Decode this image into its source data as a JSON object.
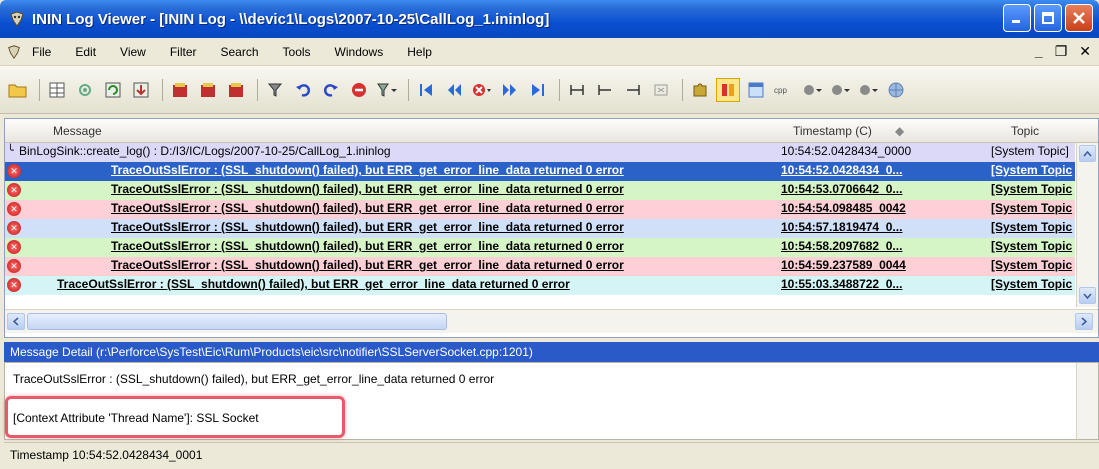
{
  "window": {
    "title": "ININ Log Viewer - [ININ Log - \\\\devic1\\Logs\\2007-10-25\\CallLog_1.ininlog]"
  },
  "menu": [
    {
      "label": "File"
    },
    {
      "label": "Edit"
    },
    {
      "label": "View"
    },
    {
      "label": "Filter"
    },
    {
      "label": "Search"
    },
    {
      "label": "Tools"
    },
    {
      "label": "Windows"
    },
    {
      "label": "Help"
    }
  ],
  "grid": {
    "columns": {
      "message": "Message",
      "timestamp": "Timestamp (C)",
      "topic": "Topic"
    },
    "rows": [
      {
        "message": "BinLogSink::create_log() : D:/I3/IC/Logs/2007-10-25/CallLog_1.ininlog",
        "timestamp": "10:54:52.0428434_0000",
        "topic": "[System Topic]"
      },
      {
        "message": "TraceOutSslError : (SSL_shutdown() failed), but ERR_get_error_line_data returned 0 error",
        "timestamp": "10:54:52.0428434_0...",
        "topic": "[System Topic"
      },
      {
        "message": "TraceOutSslError : (SSL_shutdown() failed), but ERR_get_error_line_data returned 0 error",
        "timestamp": "10:54:53.0706642_0...",
        "topic": "[System Topic"
      },
      {
        "message": "TraceOutSslError : (SSL_shutdown() failed), but ERR_get_error_line_data returned 0 error",
        "timestamp": "10:54:54.098485_0042",
        "topic": "[System Topic"
      },
      {
        "message": "TraceOutSslError : (SSL_shutdown() failed), but ERR_get_error_line_data returned 0 error",
        "timestamp": "10:54:57.1819474_0...",
        "topic": "[System Topic"
      },
      {
        "message": "TraceOutSslError : (SSL_shutdown() failed), but ERR_get_error_line_data returned 0 error",
        "timestamp": "10:54:58.2097682_0...",
        "topic": "[System Topic"
      },
      {
        "message": "TraceOutSslError : (SSL_shutdown() failed), but ERR_get_error_line_data returned 0 error",
        "timestamp": "10:54:59.237589_0044",
        "topic": "[System Topic"
      },
      {
        "message": "TraceOutSslError : (SSL_shutdown() failed), but ERR_get_error_line_data returned 0 error",
        "timestamp": "10:55:03.3488722_0...",
        "topic": "[System Topic"
      }
    ]
  },
  "detail": {
    "header": "Message Detail (r:\\Perforce\\SysTest\\Eic\\Rum\\Products\\eic\\src\\notifier\\SSLServerSocket.cpp:1201)",
    "line1": "TraceOutSslError : (SSL_shutdown() failed), but ERR_get_error_line_data returned 0 error",
    "line2": "[Context Attribute 'Thread Name']: SSL Socket"
  },
  "status": {
    "text": "Timestamp 10:54:52.0428434_0001"
  },
  "colors": {
    "title_bar": "#0a4fd0",
    "selected_row": "#2a62c8",
    "highlight_box": "#e85a6a",
    "error_icon": "#c41818"
  }
}
